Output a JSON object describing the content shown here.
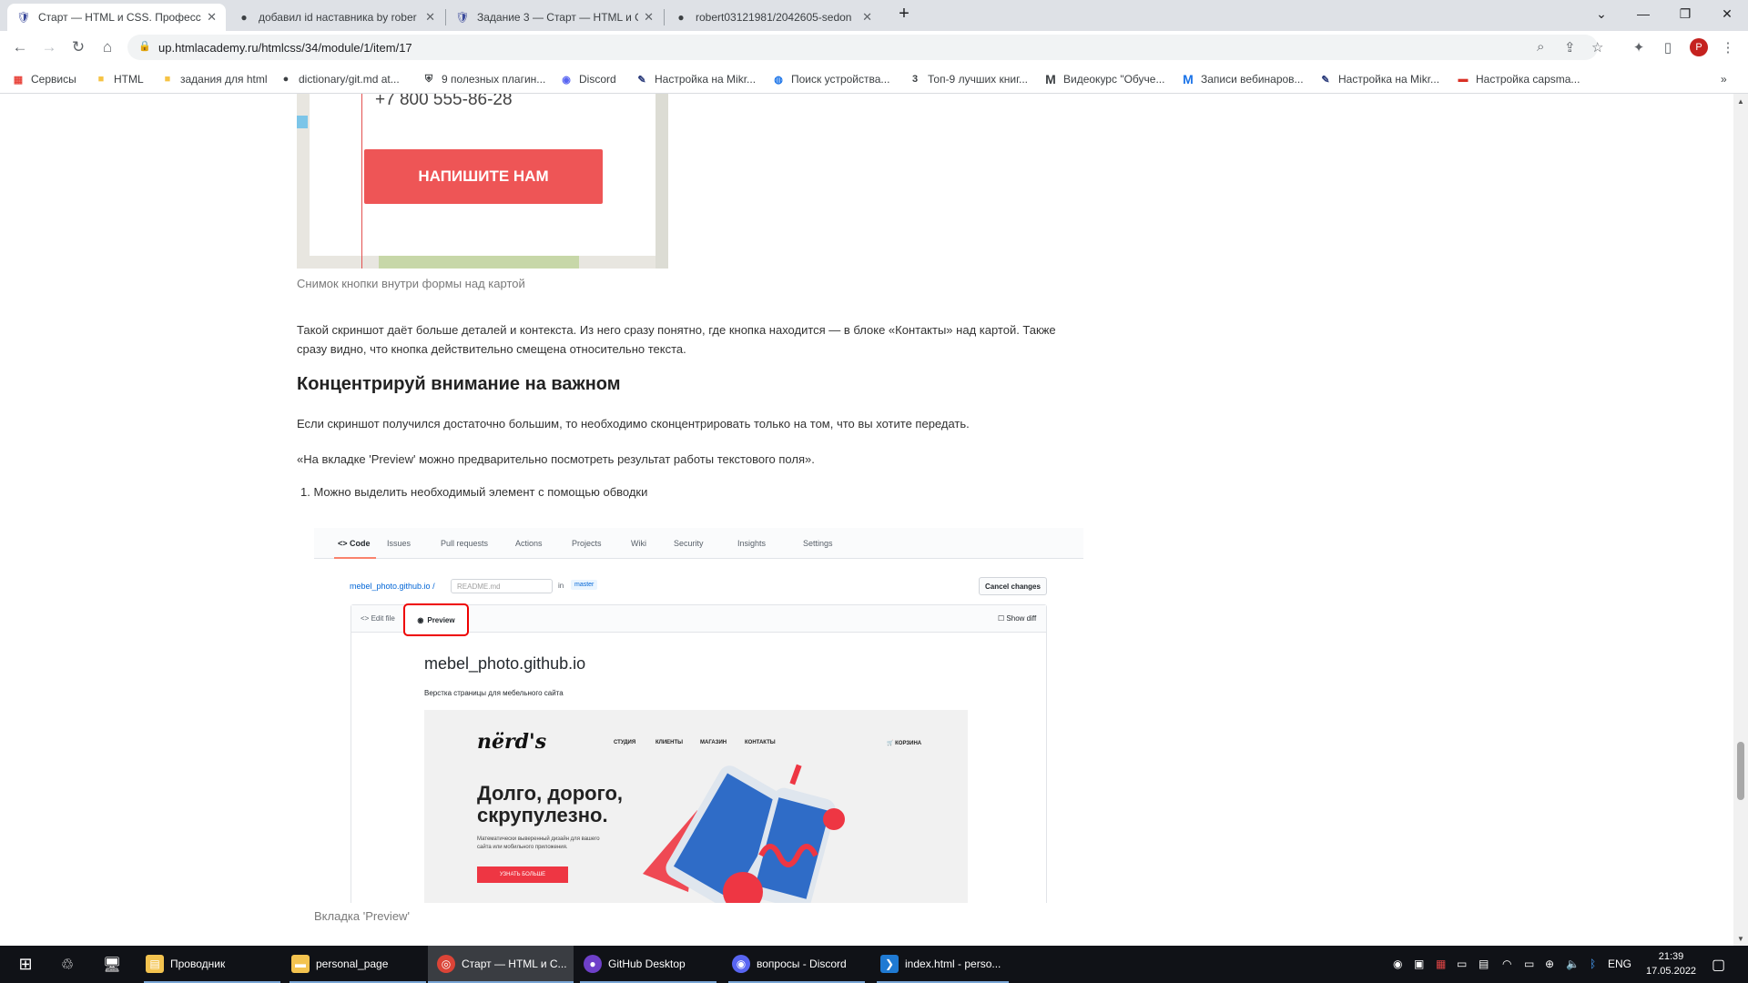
{
  "browser": {
    "tabs": [
      {
        "title": "Старт — HTML и CSS. Професси",
        "icon": "htmlacademy-icon",
        "active": true
      },
      {
        "title": "добавил id наставника by rober",
        "icon": "github-icon",
        "active": false
      },
      {
        "title": "Задание 3 — Старт — HTML и C",
        "icon": "htmlacademy-icon",
        "active": false
      },
      {
        "title": "robert03121981/2042605-sedon",
        "icon": "github-icon",
        "active": false
      }
    ],
    "new_tab": "+",
    "url": "up.htmlacademy.ru/htmlcss/34/module/1/item/17",
    "profile_initial": "P",
    "bookmarks": [
      {
        "label": "Сервисы",
        "icon": "apps-grid-icon"
      },
      {
        "label": "HTML",
        "icon": "folder-icon"
      },
      {
        "label": "задания для html",
        "icon": "folder-icon"
      },
      {
        "label": "dictionary/git.md at...",
        "icon": "github-icon"
      },
      {
        "label": "9 полезных плагин...",
        "icon": "shield-icon"
      },
      {
        "label": "Discord",
        "icon": "discord-icon"
      },
      {
        "label": "Настройка на Mikr...",
        "icon": "mikrotik-icon"
      },
      {
        "label": "Поиск устройства...",
        "icon": "search-device-icon"
      },
      {
        "label": "Топ-9 лучших книг...",
        "icon": "number-3-icon"
      },
      {
        "label": "Видеокурс \"Обуче...",
        "icon": "m-logo-icon"
      },
      {
        "label": "Записи вебинаров...",
        "icon": "m-logo-icon"
      },
      {
        "label": "Настройка на Mikr...",
        "icon": "mikrotik-icon"
      },
      {
        "label": "Настройка capsma...",
        "icon": "router-icon"
      }
    ],
    "more_bookmarks": "»"
  },
  "content": {
    "map_phone": "+7 800 555-86-28",
    "map_button": "НАПИШИТЕ НАМ",
    "caption1": "Снимок кнопки внутри формы над картой",
    "para1": "Такой скриншот даёт больше деталей и контекста. Из него сразу понятно, где кнопка находится — в блоке «Контакты» над картой. Также сразу видно, что кнопка действительно смещена относительно текста.",
    "heading": "Концентрируй внимание на важном",
    "para2": "Если скриншот получился достаточно большим, то необходимо сконцентрировать только на том, что вы хотите передать.",
    "para3": "«На вкладке 'Preview' можно предварительно посмотреть результат работы текстового поля».",
    "list_item": "1. Можно выделить необходимый элемент с помощью обводки",
    "caption2": "Вкладка 'Preview'"
  },
  "github_shot": {
    "tabs": [
      "<> Code",
      "Issues",
      "Pull requests",
      "Actions",
      "Projects",
      "Wiki",
      "Security",
      "Insights",
      "Settings"
    ],
    "path": "mebel_photo.github.io /",
    "file_placeholder": "README.md",
    "in_label": "in",
    "branch": "master",
    "cancel": "Cancel changes",
    "edit_file": "<> Edit file",
    "preview": "Preview",
    "show_diff": "Show diff",
    "title": "mebel_photo.github.io",
    "subtitle": "Верстка страницы для мебельного сайта",
    "site": {
      "logo": "nërd's",
      "nav": [
        "СТУДИЯ",
        "КЛИЕНТЫ",
        "МАГАЗИН",
        "КОНТАКТЫ"
      ],
      "cart": "КОРЗИНА",
      "headline": "Долго, дорого, скрупулезно.",
      "small": "Математически выверенный дизайн для вашего сайта или мобильного приложения.",
      "button": "УЗНАТЬ БОЛЬШЕ"
    }
  },
  "taskbar": {
    "apps": [
      {
        "label": "Проводник",
        "icon": "file-explorer-icon"
      },
      {
        "label": "personal_page",
        "icon": "folder-icon"
      },
      {
        "label": "Старт — HTML и С...",
        "icon": "chrome-icon"
      },
      {
        "label": "GitHub Desktop",
        "icon": "github-desktop-icon"
      },
      {
        "label": "вопросы - Discord",
        "icon": "discord-icon"
      },
      {
        "label": "index.html - perso...",
        "icon": "vscode-icon"
      }
    ],
    "lang": "ENG",
    "time": "21:39",
    "date": "17.05.2022"
  },
  "colors": {
    "accent_red": "#ee5556",
    "github_orange": "#f9826c",
    "chrome_frame": "#dee1e6"
  }
}
